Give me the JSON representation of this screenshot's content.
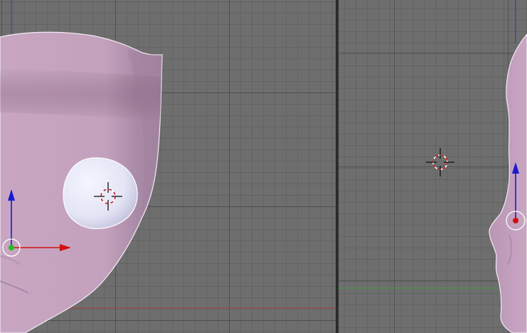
{
  "colors": {
    "viewport_bg": "#6e6e6e",
    "grid_minor": "#5a5a5a",
    "grid_major": "#464646",
    "mesh_skin": "#c9a6c1",
    "mesh_outline": "#f0e6f0",
    "eye_white": "#e6e7f5",
    "axis_x": "#d01010",
    "axis_y": "#20b020",
    "axis_z": "#1010d0",
    "divider": "#2b2b2b"
  },
  "viewports": [
    {
      "view": "front",
      "objects": [
        "head-mesh",
        "eye-mesh",
        "3d-cursor",
        "transform-manipulator"
      ]
    },
    {
      "view": "side",
      "objects": [
        "head-mesh",
        "3d-cursor",
        "transform-manipulator"
      ]
    }
  ],
  "icons": [
    "3d-cursor-icon",
    "manipulator-x-arrow-icon",
    "manipulator-z-arrow-icon",
    "object-origin-icon"
  ]
}
